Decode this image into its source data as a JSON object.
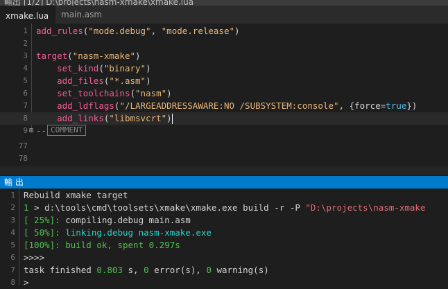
{
  "window": {
    "title": "輸出  [1/2] D:\\projects\\nasm-xmake\\xmake.lua"
  },
  "tabs": [
    {
      "label": "xmake.lua",
      "active": true
    },
    {
      "label": "main.asm",
      "active": false
    }
  ],
  "editor": {
    "lines": [
      {
        "num": "1",
        "segments": [
          [
            "fn",
            "add_rules"
          ],
          [
            "var",
            "("
          ],
          [
            "str",
            "\"mode.debug\""
          ],
          [
            "var",
            ", "
          ],
          [
            "str",
            "\"mode.release\""
          ],
          [
            "var",
            ")"
          ]
        ]
      },
      {
        "num": "2",
        "segments": []
      },
      {
        "num": "3",
        "segments": [
          [
            "fn",
            "target"
          ],
          [
            "var",
            "("
          ],
          [
            "str",
            "\"nasm-xmake\""
          ],
          [
            "var",
            ")"
          ]
        ]
      },
      {
        "num": "4",
        "segments": [
          [
            "var",
            "    "
          ],
          [
            "fn",
            "set_kind"
          ],
          [
            "var",
            "("
          ],
          [
            "str",
            "\"binary\""
          ],
          [
            "var",
            ")"
          ]
        ]
      },
      {
        "num": "5",
        "segments": [
          [
            "var",
            "    "
          ],
          [
            "fn",
            "add_files"
          ],
          [
            "var",
            "("
          ],
          [
            "str",
            "\"*.asm\""
          ],
          [
            "var",
            ")"
          ]
        ]
      },
      {
        "num": "6",
        "segments": [
          [
            "var",
            "    "
          ],
          [
            "fn",
            "set_toolchains"
          ],
          [
            "var",
            "("
          ],
          [
            "str",
            "\"nasm\""
          ],
          [
            "var",
            ")"
          ]
        ]
      },
      {
        "num": "7",
        "segments": [
          [
            "var",
            "    "
          ],
          [
            "fn",
            "add_ldflags"
          ],
          [
            "var",
            "("
          ],
          [
            "str",
            "\"/LARGEADDRESSAWARE:NO /SUBSYSTEM:console\""
          ],
          [
            "var",
            ", {"
          ],
          [
            "var",
            "force"
          ],
          [
            "var",
            "="
          ],
          [
            "kw",
            "true"
          ],
          [
            "var",
            "})"
          ]
        ]
      },
      {
        "num": "8",
        "segments": [
          [
            "var",
            "    "
          ],
          [
            "fn",
            "add_links"
          ],
          [
            "var",
            "("
          ],
          [
            "str",
            "\"libmsvcrt\""
          ],
          [
            "var",
            ")"
          ]
        ],
        "current": true
      }
    ],
    "fold_line": {
      "num": "9",
      "dashes": "--",
      "comment": "COMMENT"
    },
    "tail_lines": [
      "77",
      "78"
    ]
  },
  "panel": {
    "title": "輸 出"
  },
  "output": {
    "lines": [
      {
        "num": "1",
        "segments": [
          [
            "plain",
            "Rebuild xmake target"
          ]
        ]
      },
      {
        "num": "2",
        "segments": [
          [
            "green",
            "1"
          ],
          [
            "plain",
            " > d:\\tools\\cmd\\toolsets\\xmake\\xmake.exe build -r -P "
          ],
          [
            "ored",
            "\"D:\\projects\\nasm-xmake"
          ]
        ]
      },
      {
        "num": "3",
        "segments": [
          [
            "green",
            "[ 25%]:"
          ],
          [
            "plain",
            " compiling.debug main.asm"
          ]
        ]
      },
      {
        "num": "4",
        "segments": [
          [
            "green",
            "[ 50%]:"
          ],
          [
            "plain",
            " "
          ],
          [
            "cyan",
            "linking.debug nasm-xmake.exe"
          ]
        ]
      },
      {
        "num": "5",
        "segments": [
          [
            "green",
            "[100%]: build ok, spent 0.297s"
          ]
        ]
      },
      {
        "num": "6",
        "segments": [
          [
            "plain",
            ">>>>"
          ]
        ]
      },
      {
        "num": "7",
        "segments": [
          [
            "plain",
            "task finished "
          ],
          [
            "green",
            "0.803"
          ],
          [
            "plain",
            " s, "
          ],
          [
            "green",
            "0"
          ],
          [
            "plain",
            " error(s), "
          ],
          [
            "green",
            "0"
          ],
          [
            "plain",
            " warning(s)"
          ]
        ]
      },
      {
        "num": "8",
        "segments": [
          [
            "plain",
            ">"
          ]
        ]
      }
    ]
  }
}
